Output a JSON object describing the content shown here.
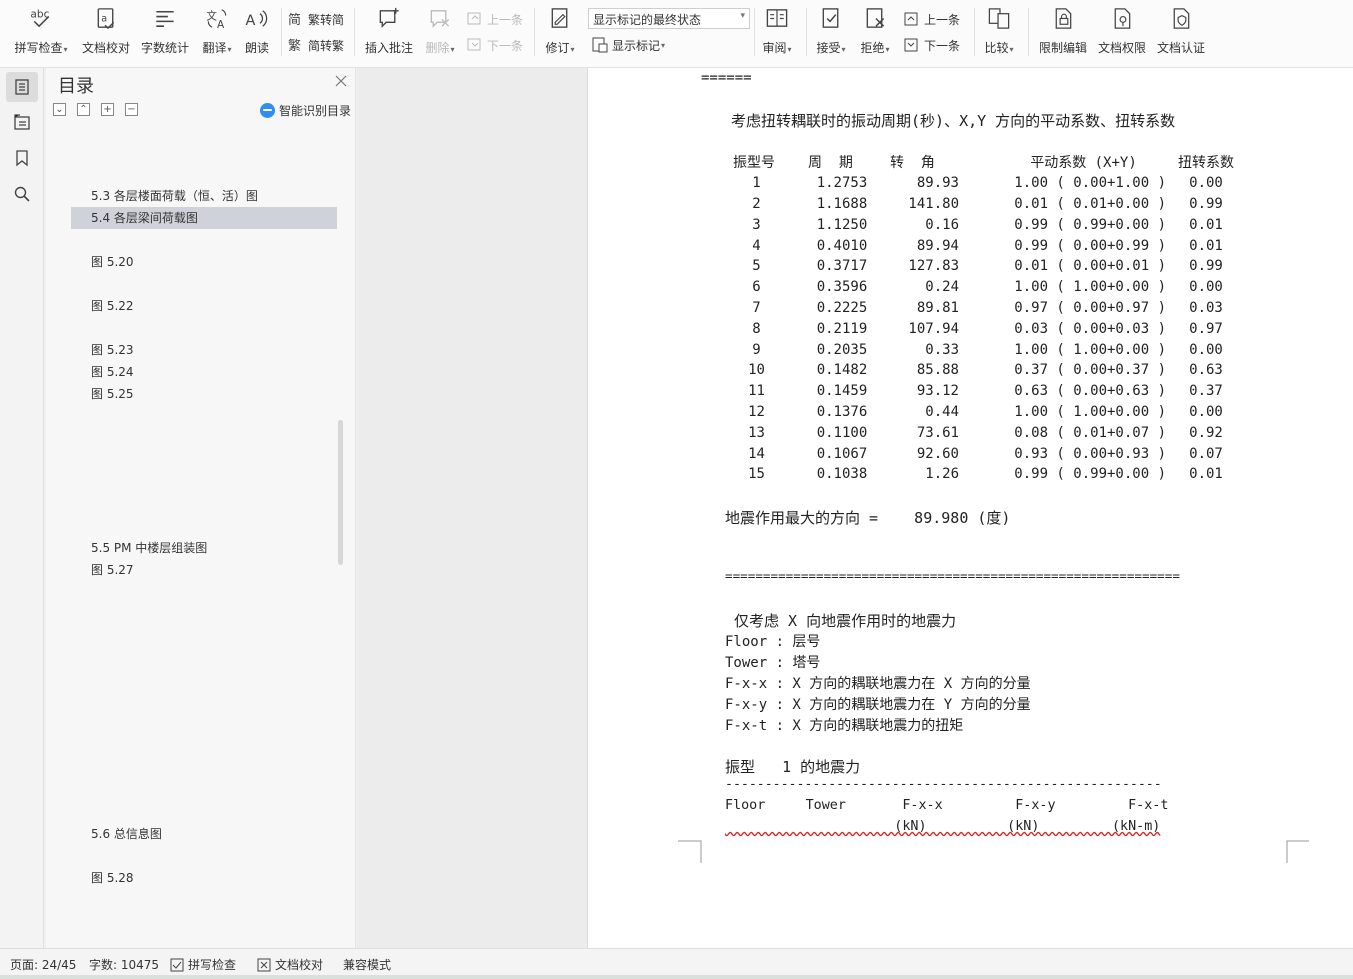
{
  "toolbar": {
    "spell_check": "拼写检查",
    "doc_proof": "文档校对",
    "word_count": "字数统计",
    "translate": "翻译",
    "read_aloud": "朗读",
    "to_traditional": "繁转简",
    "to_simplified": "简转繁",
    "insert_comment": "插入批注",
    "delete": "删除",
    "prev_comment": "上一条",
    "next_comment": "下一条",
    "revise": "修订",
    "markup_state": "显示标记的最终状态",
    "show_markup": "显示标记",
    "review": "审阅",
    "accept": "接受",
    "reject": "拒绝",
    "prev_change": "上一条",
    "next_change": "下一条",
    "compare": "比较",
    "restrict_edit": "限制编辑",
    "doc_permission": "文档权限",
    "doc_auth": "文档认证"
  },
  "toc": {
    "title": "目录",
    "ai_toc": "智能识别目录",
    "items": [
      {
        "label": "5.3  各层楼面荷载（恒、活）图"
      },
      {
        "label": "5.4  各层梁间荷载图"
      },
      {
        "label": "图 5.20"
      },
      {
        "label": "图 5.22"
      },
      {
        "label": "图 5.23"
      },
      {
        "label": "图 5.24"
      },
      {
        "label": "图 5.25"
      },
      {
        "label": "5.5 PM 中楼层组装图"
      },
      {
        "label": "图 5.27"
      },
      {
        "label": "5.6  总信息图"
      },
      {
        "label": "图 5.28"
      }
    ]
  },
  "document": {
    "top_rule": "======",
    "section_title": "考虑扭转耦联时的振动周期(秒)、X,Y 方向的平动系数、扭转系数",
    "table_headers": {
      "mode": "振型号",
      "period": "周  期",
      "angle": "转  角",
      "trans": "平动系数 (X+Y)",
      "torsion": "扭转系数"
    },
    "rows": [
      {
        "mode": "1",
        "period": "1.2753",
        "angle": "89.93",
        "trans": "1.00 ( 0.00+1.00 )",
        "torsion": "0.00"
      },
      {
        "mode": "2",
        "period": "1.1688",
        "angle": "141.80",
        "trans": "0.01 ( 0.01+0.00 )",
        "torsion": "0.99"
      },
      {
        "mode": "3",
        "period": "1.1250",
        "angle": "0.16",
        "trans": "0.99 ( 0.99+0.00 )",
        "torsion": "0.01"
      },
      {
        "mode": "4",
        "period": "0.4010",
        "angle": "89.94",
        "trans": "0.99 ( 0.00+0.99 )",
        "torsion": "0.01"
      },
      {
        "mode": "5",
        "period": "0.3717",
        "angle": "127.83",
        "trans": "0.01 ( 0.00+0.01 )",
        "torsion": "0.99"
      },
      {
        "mode": "6",
        "period": "0.3596",
        "angle": "0.24",
        "trans": "1.00 ( 1.00+0.00 )",
        "torsion": "0.00"
      },
      {
        "mode": "7",
        "period": "0.2225",
        "angle": "89.81",
        "trans": "0.97 ( 0.00+0.97 )",
        "torsion": "0.03"
      },
      {
        "mode": "8",
        "period": "0.2119",
        "angle": "107.94",
        "trans": "0.03 ( 0.00+0.03 )",
        "torsion": "0.97"
      },
      {
        "mode": "9",
        "period": "0.2035",
        "angle": "0.33",
        "trans": "1.00 ( 1.00+0.00 )",
        "torsion": "0.00"
      },
      {
        "mode": "10",
        "period": "0.1482",
        "angle": "85.88",
        "trans": "0.37 ( 0.00+0.37 )",
        "torsion": "0.63"
      },
      {
        "mode": "11",
        "period": "0.1459",
        "angle": "93.12",
        "trans": "0.63 ( 0.00+0.63 )",
        "torsion": "0.37"
      },
      {
        "mode": "12",
        "period": "0.1376",
        "angle": "0.44",
        "trans": "1.00 ( 1.00+0.00 )",
        "torsion": "0.00"
      },
      {
        "mode": "13",
        "period": "0.1100",
        "angle": "73.61",
        "trans": "0.08 ( 0.01+0.07 )",
        "torsion": "0.92"
      },
      {
        "mode": "14",
        "period": "0.1067",
        "angle": "92.60",
        "trans": "0.93 ( 0.00+0.93 )",
        "torsion": "0.07"
      },
      {
        "mode": "15",
        "period": "0.1038",
        "angle": "1.26",
        "trans": "0.99 ( 0.99+0.00 )",
        "torsion": "0.01"
      }
    ],
    "max_direction": "地震作用最大的方向 =    89.980 (度)",
    "double_rule": "============================================================",
    "x_force_title": " 仅考虑 X 向地震作用时的地震力",
    "defs": [
      "Floor : 层号",
      "Tower : 塔号",
      "F-x-x : X 方向的耦联地震力在 X 方向的分量",
      "F-x-y : X 方向的耦联地震力在 Y 方向的分量",
      "F-x-t : X 方向的耦联地震力的扭矩"
    ],
    "mode1_title": "振型   1 的地震力",
    "dash_rule": "-------------------------------------------------------",
    "force_headers": "Floor     Tower       F-x-x         F-x-y         F-x-t",
    "force_units": "                     (kN)          (kN)         (kN-m)"
  },
  "status": {
    "page": "页面: 24/45",
    "words": "字数: 10475",
    "spell": "拼写检查",
    "proof": "文档校对",
    "compat": "兼容模式"
  },
  "colors": {
    "accent": "#2f8ef2",
    "selection": "#cfd3d9"
  }
}
